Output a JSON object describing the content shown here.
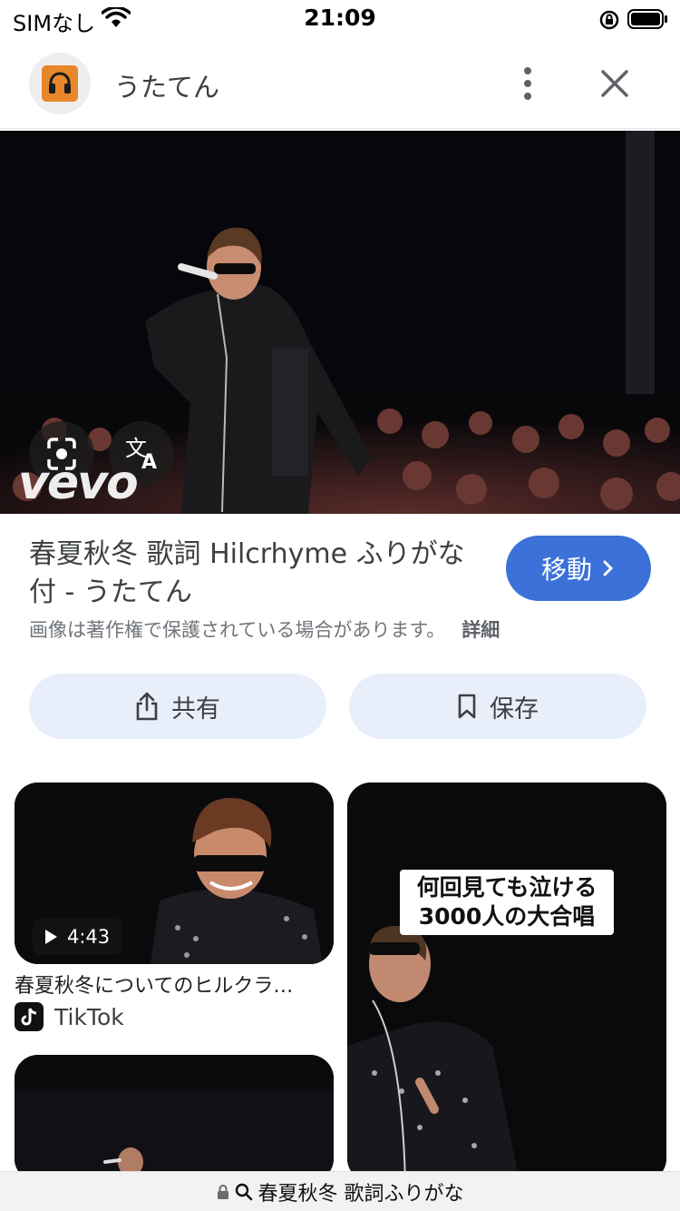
{
  "status_bar": {
    "carrier": "SIMなし",
    "time": "21:09"
  },
  "header": {
    "app_name": "うたてん"
  },
  "hero": {
    "watermark": "vevo"
  },
  "result": {
    "title": "春夏秋冬 歌詞 Hilcrhyme ふりがな付 - うたてん",
    "visit_label": "移動",
    "copyright_notice": "画像は著作権で保護されている場合があります。",
    "details_label": "詳細"
  },
  "actions": {
    "share_label": "共有",
    "save_label": "保存"
  },
  "related": [
    {
      "duration": "4:43",
      "title": "春夏秋冬についてのヒルクラ…",
      "source": "TikTok"
    },
    {
      "caption": "何回見ても泣ける 3000人の大合唱"
    }
  ],
  "url_bar": {
    "query": "春夏秋冬 歌詞ふりがな"
  },
  "colors": {
    "accent": "#3b71d8",
    "pill_bg": "#e8effa",
    "app_icon": "#e8862a"
  }
}
